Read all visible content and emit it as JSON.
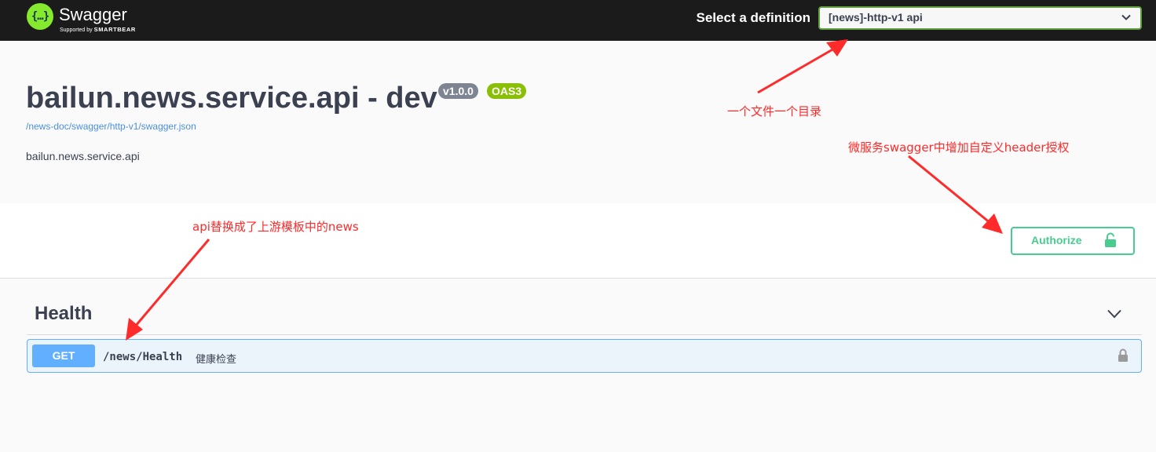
{
  "topbar": {
    "logo_text": "Swagger",
    "logo_mark": "{…}",
    "logo_sub_prefix": "Supported by",
    "logo_sub_brand": "SMARTBEAR",
    "select_label": "Select a definition",
    "select_value": "[news]-http-v1 api"
  },
  "info": {
    "title": "bailun.news.service.api - dev",
    "version_badge": "v1.0.0",
    "oas_badge": "OAS3",
    "spec_url": "/news-doc/swagger/http-v1/swagger.json",
    "description": "bailun.news.service.api"
  },
  "auth": {
    "button_label": "Authorize"
  },
  "tag": {
    "name": "Health"
  },
  "operation": {
    "method": "GET",
    "path": "/news/Health",
    "summary": "健康检查"
  },
  "annotations": {
    "definition_note": "一个文件一个目录",
    "auth_note": "微服务swagger中增加自定义header授权",
    "path_note": "api替换成了上游模板中的news"
  },
  "colors": {
    "topbar": "#1b1b1b",
    "logo_green": "#85ea2d",
    "select_border": "#62a03f",
    "authorize_green": "#49cc90",
    "get_blue": "#61affe",
    "get_bg": "#ebf3fb",
    "version_badge": "#7d8492",
    "oas_badge": "#89bf04",
    "annotation_red": "#ff2a2a"
  },
  "icons": [
    "swagger-logo-icon",
    "chevron-down-icon",
    "unlock-icon",
    "lock-icon",
    "arrow-annotation-icon"
  ]
}
